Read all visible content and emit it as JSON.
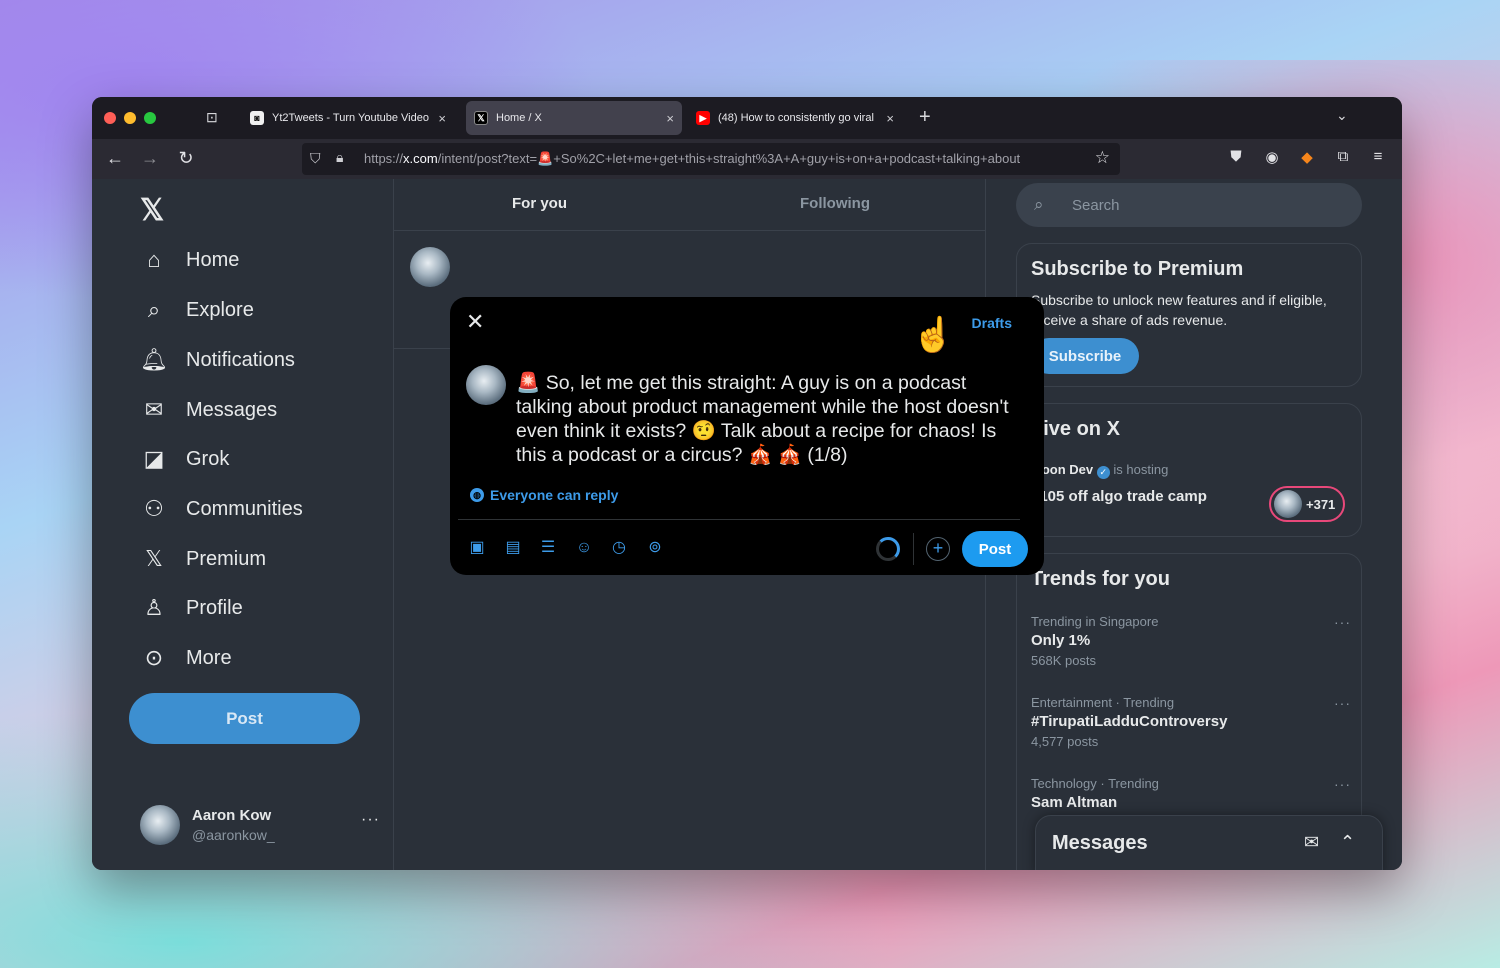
{
  "browser": {
    "tabs": [
      {
        "title": "Yt2Tweets - Turn Youtube Video",
        "close": "×",
        "favicon": "yt2tweets-icon",
        "active": false
      },
      {
        "title": "Home / X",
        "close": "×",
        "favicon": "x-logo-icon",
        "active": true
      },
      {
        "title": "(48) How to consistently go viral",
        "close": "×",
        "favicon": "youtube-icon",
        "active": false
      }
    ],
    "new_tab": "+",
    "url_prefix": "https://",
    "url_domain": "x.com",
    "url_rest": "/intent/post?text=🚨+So%2C+let+me+get+this+straight%3A+A+guy+is+on+a+podcast+talking+about"
  },
  "sidebar": {
    "items": [
      {
        "label": "Home",
        "icon": "home-icon"
      },
      {
        "label": "Explore",
        "icon": "search-icon"
      },
      {
        "label": "Notifications",
        "icon": "bell-icon"
      },
      {
        "label": "Messages",
        "icon": "envelope-icon"
      },
      {
        "label": "Grok",
        "icon": "grok-icon"
      },
      {
        "label": "Communities",
        "icon": "communities-icon"
      },
      {
        "label": "Premium",
        "icon": "x-logo-icon"
      },
      {
        "label": "Profile",
        "icon": "person-icon"
      },
      {
        "label": "More",
        "icon": "more-circle-icon"
      }
    ],
    "post_label": "Post",
    "account": {
      "name": "Aaron Kow",
      "handle": "@aaronkow_",
      "menu": "···"
    }
  },
  "timeline": {
    "tabs": [
      "For you",
      "Following"
    ]
  },
  "right": {
    "search_placeholder": "Search",
    "premium": {
      "title": "Subscribe to Premium",
      "text": "Subscribe to unlock new features and if eligible, receive a share of ads revenue.",
      "button": "Subscribe"
    },
    "live": {
      "title": "Live on X",
      "host": "Moon Dev",
      "hosting": "is hosting",
      "event": "$105 off algo trade camp",
      "count": "+371"
    },
    "trends": {
      "title": "Trends for you",
      "items": [
        {
          "category": "Trending in Singapore",
          "name": "Only 1%",
          "posts": "568K posts"
        },
        {
          "category": "Entertainment · Trending",
          "name": "#TirupatiLadduControversy",
          "posts": "4,577 posts"
        },
        {
          "category": "Technology · Trending",
          "name": "Sam Altman",
          "posts": ""
        }
      ],
      "more": "···"
    },
    "messages_dock": "Messages"
  },
  "compose": {
    "close": "✕",
    "drafts": "Drafts",
    "text": "🚨 So, let me get this straight: A guy is on a podcast talking about product management while the host doesn't even think it exists? 🤨 Talk about a recipe for chaos! Is this a podcast or a circus? 🎪 🎪 (1/8)",
    "reply_setting": "Everyone can reply",
    "post_label": "Post",
    "plus": "+"
  }
}
